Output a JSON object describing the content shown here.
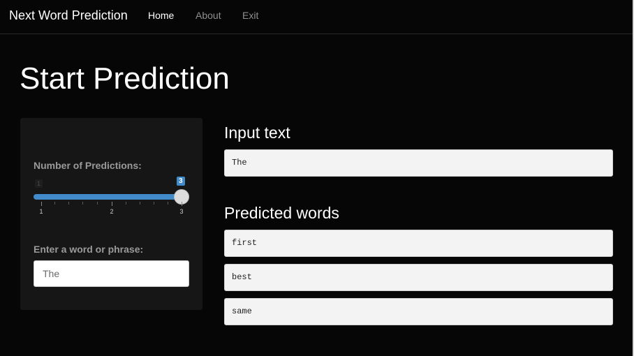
{
  "navbar": {
    "brand": "Next Word Prediction",
    "links": [
      {
        "label": "Home",
        "active": true
      },
      {
        "label": "About",
        "active": false
      },
      {
        "label": "Exit",
        "active": false
      }
    ]
  },
  "page_title": "Start Prediction",
  "sidebar": {
    "slider": {
      "label": "Number of Predictions:",
      "min": 1,
      "max": 3,
      "value": 3,
      "min_label": "1",
      "value_label": "3",
      "tick_labels": [
        "1",
        "2",
        "3"
      ]
    },
    "text_input": {
      "label": "Enter a word or phrase:",
      "value": "The"
    }
  },
  "main": {
    "input_heading": "Input text",
    "input_text": "The",
    "predicted_heading": "Predicted words",
    "predictions": [
      "first",
      "best",
      "same"
    ]
  },
  "colors": {
    "background": "#060606",
    "panel": "#161616",
    "accent": "#428bca",
    "output_box": "#f3f3f3"
  }
}
